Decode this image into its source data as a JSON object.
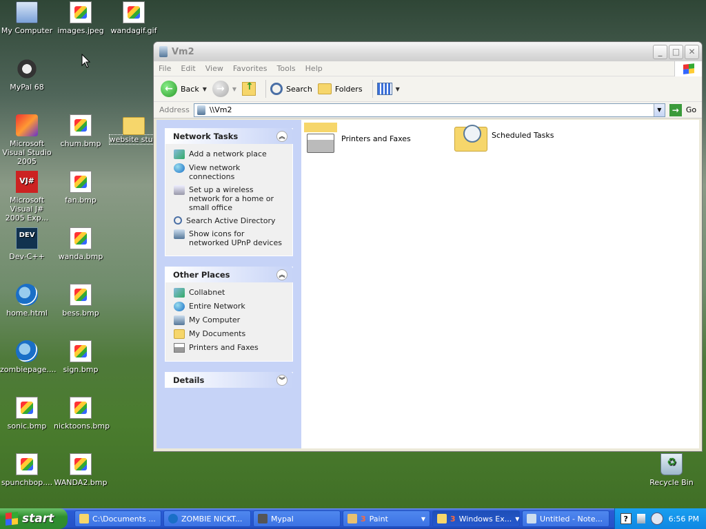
{
  "desktop": {
    "icons": [
      {
        "label": "My Computer"
      },
      {
        "label": "images.jpeg"
      },
      {
        "label": "wandagif.gif"
      },
      {
        "label": "MyPal 68"
      },
      {
        "label": "Microsoft Visual Studio 2005"
      },
      {
        "label": "chum.bmp"
      },
      {
        "label": "website stuff"
      },
      {
        "label": "Microsoft Visual J# 2005 Exp..."
      },
      {
        "label": "fan.bmp"
      },
      {
        "label": "Dev-C++"
      },
      {
        "label": "wanda.bmp"
      },
      {
        "label": "home.html"
      },
      {
        "label": "bess.bmp"
      },
      {
        "label": "zombiepage...."
      },
      {
        "label": "sign.bmp"
      },
      {
        "label": "sonic.bmp"
      },
      {
        "label": "nicktoons.bmp"
      },
      {
        "label": "spunchbop...."
      },
      {
        "label": "WANDA2.bmp"
      },
      {
        "label": "Recycle Bin"
      }
    ],
    "dev_icon_text": "DEV",
    "vj_icon_text": "VJ#"
  },
  "window": {
    "title": "Vm2",
    "menu": [
      "File",
      "Edit",
      "View",
      "Favorites",
      "Tools",
      "Help"
    ],
    "toolbar": {
      "back": "Back",
      "search": "Search",
      "folders": "Folders"
    },
    "address": {
      "label": "Address",
      "value": "\\\\Vm2",
      "go": "Go"
    },
    "network_tasks": {
      "title": "Network Tasks",
      "items": [
        "Add a network place",
        "View network connections",
        "Set up a wireless network for a home or small office",
        "Search Active Directory",
        "Show icons for networked UPnP devices"
      ]
    },
    "other_places": {
      "title": "Other Places",
      "items": [
        "Collabnet",
        "Entire Network",
        "My Computer",
        "My Documents",
        "Printers and Faxes"
      ]
    },
    "details": {
      "title": "Details"
    },
    "items": [
      "Printers and Faxes",
      "Scheduled Tasks"
    ]
  },
  "taskbar": {
    "start": "start",
    "tasks": [
      {
        "label": "C:\\Documents ...",
        "count": "",
        "dropdown": false
      },
      {
        "label": "ZOMBIE NICKT...",
        "count": "",
        "dropdown": false
      },
      {
        "label": "Mypal",
        "count": "",
        "dropdown": false
      },
      {
        "label": "Paint",
        "count": "3",
        "dropdown": true
      },
      {
        "label": "Windows Ex...",
        "count": "3",
        "dropdown": true
      },
      {
        "label": "Untitled - Note...",
        "count": "",
        "dropdown": false
      }
    ],
    "help_icon": "?",
    "clock": "6:56 PM"
  },
  "colors": {
    "taskbar_blue": "#2552c9",
    "start_green": "#2f8f2f",
    "taskpane_bg": "#c6d3f7"
  }
}
